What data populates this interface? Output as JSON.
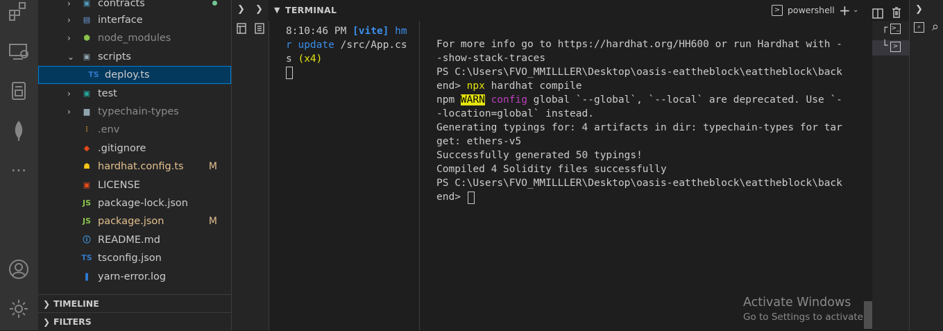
{
  "explorer": {
    "items": [
      {
        "label": "contracts",
        "color": "#cccccc"
      },
      {
        "label": "interface",
        "color": "#cccccc"
      },
      {
        "label": "node_modules",
        "color": "#8b8b8b"
      },
      {
        "label": "scripts",
        "color": "#cccccc"
      },
      {
        "label": "deploy.ts",
        "color": "#cccccc"
      },
      {
        "label": "test",
        "color": "#cccccc"
      },
      {
        "label": "typechain-types",
        "color": "#8b8b8b"
      },
      {
        "label": ".env",
        "color": "#8b8b8b"
      },
      {
        "label": ".gitignore",
        "color": "#cccccc"
      },
      {
        "label": "hardhat.config.ts",
        "color": "#e2c08d",
        "badge": "M"
      },
      {
        "label": "LICENSE",
        "color": "#cccccc"
      },
      {
        "label": "package-lock.json",
        "color": "#cccccc"
      },
      {
        "label": "package.json",
        "color": "#e2c08d",
        "badge": "M"
      },
      {
        "label": "README.md",
        "color": "#cccccc"
      },
      {
        "label": "tsconfig.json",
        "color": "#cccccc"
      },
      {
        "label": "yarn-error.log",
        "color": "#cccccc"
      }
    ],
    "timeline_label": "TIMELINE",
    "filters_label": "FILTERS"
  },
  "terminal": {
    "title": "TERMINAL",
    "shell_label": "powershell",
    "left_pane": {
      "line1_time": "8:10:46 PM ",
      "line1_tag": "[vite]",
      "line1_hm": " hm",
      "line2_r": "r ",
      "line2_update": "update",
      "line2_path": " /src/App.cs",
      "line3_s": "s ",
      "line3_count": "(x4)"
    },
    "right_pane": {
      "lines": [
        "For more info go to https://hardhat.org/HH600 or run Hardhat with -",
        "-show-stack-traces",
        "PS C:\\Users\\FVO_MMILLLER\\Desktop\\oasis-eattheblock\\eattheblock\\back",
        "end> ",
        "npm ",
        "Generating typings for: 4 artifacts in dir: typechain-types for tar",
        "get: ethers-v5",
        "Successfully generated 50 typings!",
        "Compiled 4 Solidity files successfully",
        "PS C:\\Users\\FVO_MMILLLER\\Desktop\\oasis-eattheblock\\eattheblock\\back",
        "end> "
      ],
      "cmd_npx": "npx",
      "cmd_rest": " hardhat compile",
      "warn": "WARN",
      "config": " config",
      "warn_rest1": " global `--global`, `--local` are deprecated. Use `-",
      "warn_rest2": "-location=global` instead."
    }
  },
  "watermark": {
    "title": "Activate Windows",
    "subtitle": "Go to Settings to activate Windows."
  },
  "colors": {
    "accent": "#007fd4",
    "modified": "#e2c08d",
    "vite_tag": "#3b8eea",
    "warn_bg": "#e5e510",
    "config": "#bc3fbc",
    "npx": "#e5e510"
  }
}
